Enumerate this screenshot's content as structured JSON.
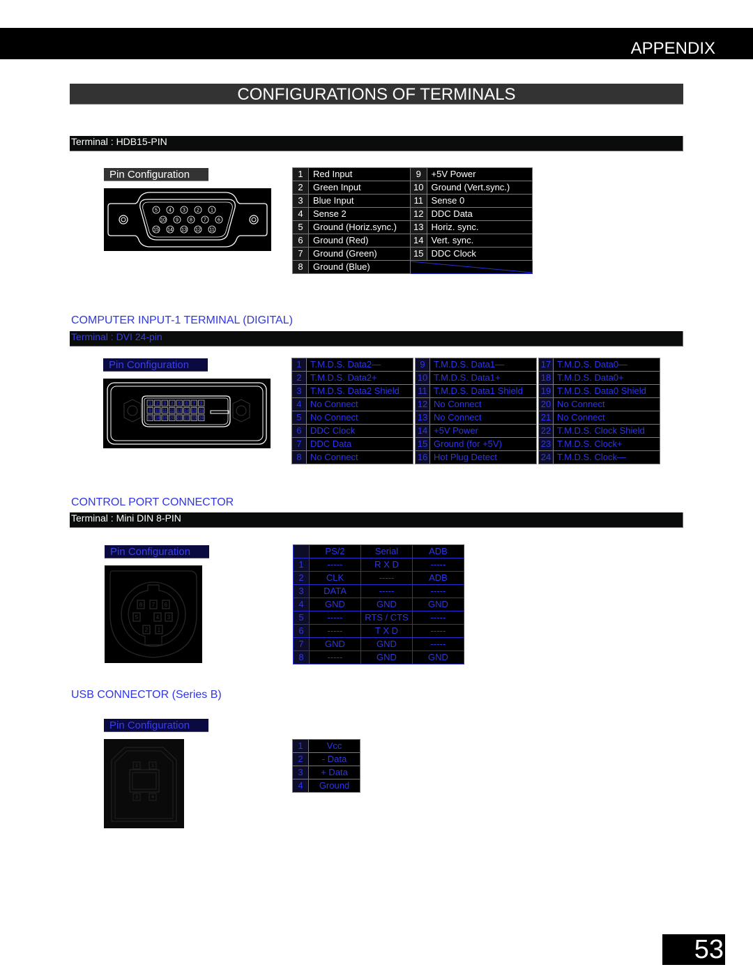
{
  "header": {
    "section": "APPENDIX",
    "title": "CONFIGURATIONS OF TERMINALS"
  },
  "vga": {
    "terminal": "Terminal : HDB15-PIN",
    "pin_label": "Pin Configuration",
    "pins_left": [
      {
        "n": "1",
        "d": "Red Input"
      },
      {
        "n": "2",
        "d": "Green Input"
      },
      {
        "n": "3",
        "d": "Blue Input"
      },
      {
        "n": "4",
        "d": "Sense 2"
      },
      {
        "n": "5",
        "d": "Ground (Horiz.sync.)"
      },
      {
        "n": "6",
        "d": "Ground (Red)"
      },
      {
        "n": "7",
        "d": "Ground (Green)"
      },
      {
        "n": "8",
        "d": "Ground (Blue)"
      }
    ],
    "pins_right": [
      {
        "n": "9",
        "d": "+5V Power"
      },
      {
        "n": "10",
        "d": "Ground (Vert.sync.)"
      },
      {
        "n": "11",
        "d": "Sense 0"
      },
      {
        "n": "12",
        "d": "DDC Data"
      },
      {
        "n": "13",
        "d": "Horiz. sync."
      },
      {
        "n": "14",
        "d": "Vert. sync."
      },
      {
        "n": "15",
        "d": "DDC Clock"
      }
    ],
    "connector_rows": [
      [
        "5",
        "4",
        "3",
        "2",
        "1"
      ],
      [
        "10",
        "9",
        "8",
        "7",
        "6"
      ],
      [
        "15",
        "14",
        "13",
        "12",
        "11"
      ]
    ]
  },
  "dvi": {
    "section_title": "COMPUTER INPUT-1 TERMINAL (DIGITAL)",
    "terminal": "Terminal : DVI 24-pin",
    "pin_label": "Pin Configuration",
    "pins": [
      [
        {
          "n": "1",
          "d": "T.M.D.S. Data2—"
        },
        {
          "n": "9",
          "d": "T.M.D.S. Data1—"
        },
        {
          "n": "17",
          "d": "T.M.D.S. Data0—"
        }
      ],
      [
        {
          "n": "2",
          "d": "T.M.D.S. Data2+"
        },
        {
          "n": "10",
          "d": "T.M.D.S. Data1+"
        },
        {
          "n": "18",
          "d": "T.M.D.S. Data0+"
        }
      ],
      [
        {
          "n": "3",
          "d": "T.M.D.S. Data2 Shield"
        },
        {
          "n": "11",
          "d": "T.M.D.S. Data1 Shield"
        },
        {
          "n": "19",
          "d": "T.M.D.S. Data0 Shield"
        }
      ],
      [
        {
          "n": "4",
          "d": "No Connect"
        },
        {
          "n": "12",
          "d": "No Connect"
        },
        {
          "n": "20",
          "d": "No Connect"
        }
      ],
      [
        {
          "n": "5",
          "d": "No Connect"
        },
        {
          "n": "13",
          "d": "No Connect"
        },
        {
          "n": "21",
          "d": "No Connect"
        }
      ],
      [
        {
          "n": "6",
          "d": "DDC Clock"
        },
        {
          "n": "14",
          "d": "+5V Power"
        },
        {
          "n": "22",
          "d": "T.M.D.S. Clock Shield"
        }
      ],
      [
        {
          "n": "7",
          "d": "DDC Data"
        },
        {
          "n": "15",
          "d": "Ground (for +5V)"
        },
        {
          "n": "23",
          "d": "T.M.D.S. Clock+"
        }
      ],
      [
        {
          "n": "8",
          "d": "No Connect"
        },
        {
          "n": "16",
          "d": "Hot Plug Detect"
        },
        {
          "n": "24",
          "d": "T.M.D.S. Clock—"
        }
      ]
    ]
  },
  "control": {
    "section_title": "CONTROL PORT CONNECTOR",
    "terminal": "Terminal : Mini DIN 8-PIN",
    "pin_label": "Pin Configuration",
    "columns": [
      "PS/2",
      "Serial",
      "ADB"
    ],
    "rows": [
      {
        "n": "1",
        "v": [
          "-----",
          "R X D",
          "-----"
        ]
      },
      {
        "n": "2",
        "v": [
          "CLK",
          "-----",
          "ADB"
        ]
      },
      {
        "n": "3",
        "v": [
          "DATA",
          "-----",
          "-----"
        ]
      },
      {
        "n": "4",
        "v": [
          "GND",
          "GND",
          "GND"
        ]
      },
      {
        "n": "5",
        "v": [
          "-----",
          "RTS / CTS",
          "-----"
        ]
      },
      {
        "n": "6",
        "v": [
          "-----",
          "T X D",
          "-----"
        ]
      },
      {
        "n": "7",
        "v": [
          "GND",
          "GND",
          "-----"
        ]
      },
      {
        "n": "8",
        "v": [
          "-----",
          "GND",
          "GND"
        ]
      }
    ],
    "connector_pins": [
      "1",
      "2",
      "3",
      "4",
      "5",
      "6",
      "7",
      "8"
    ]
  },
  "usb": {
    "section_title": "USB CONNECTOR (Series B)",
    "pin_label": "Pin Configuration",
    "rows": [
      {
        "n": "1",
        "d": "Vcc"
      },
      {
        "n": "2",
        "d": "- Data"
      },
      {
        "n": "3",
        "d": "+ Data"
      },
      {
        "n": "4",
        "d": "Ground"
      }
    ],
    "connector_pins": [
      "1",
      "2",
      "3",
      "4"
    ]
  },
  "page_number": "53"
}
